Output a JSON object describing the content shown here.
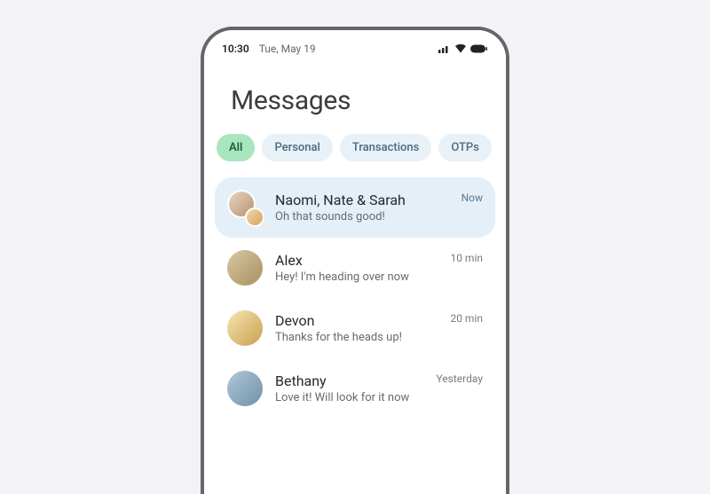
{
  "status": {
    "time": "10:30",
    "date": "Tue, May 19"
  },
  "title": "Messages",
  "tabs": [
    {
      "label": "All",
      "active": true
    },
    {
      "label": "Personal",
      "active": false
    },
    {
      "label": "Transactions",
      "active": false
    },
    {
      "label": "OTPs",
      "active": false
    }
  ],
  "conversations": [
    {
      "name": "Naomi, Nate & Sarah",
      "preview": "Oh that sounds good!",
      "time": "Now",
      "highlight": true,
      "group": true
    },
    {
      "name": "Alex",
      "preview": "Hey! I'm heading over now",
      "time": "10 min",
      "highlight": false,
      "group": false
    },
    {
      "name": "Devon",
      "preview": "Thanks for the heads up!",
      "time": "20 min",
      "highlight": false,
      "group": false
    },
    {
      "name": "Bethany",
      "preview": "Love it! Will look for it now",
      "time": "Yesterday",
      "highlight": false,
      "group": false
    }
  ]
}
